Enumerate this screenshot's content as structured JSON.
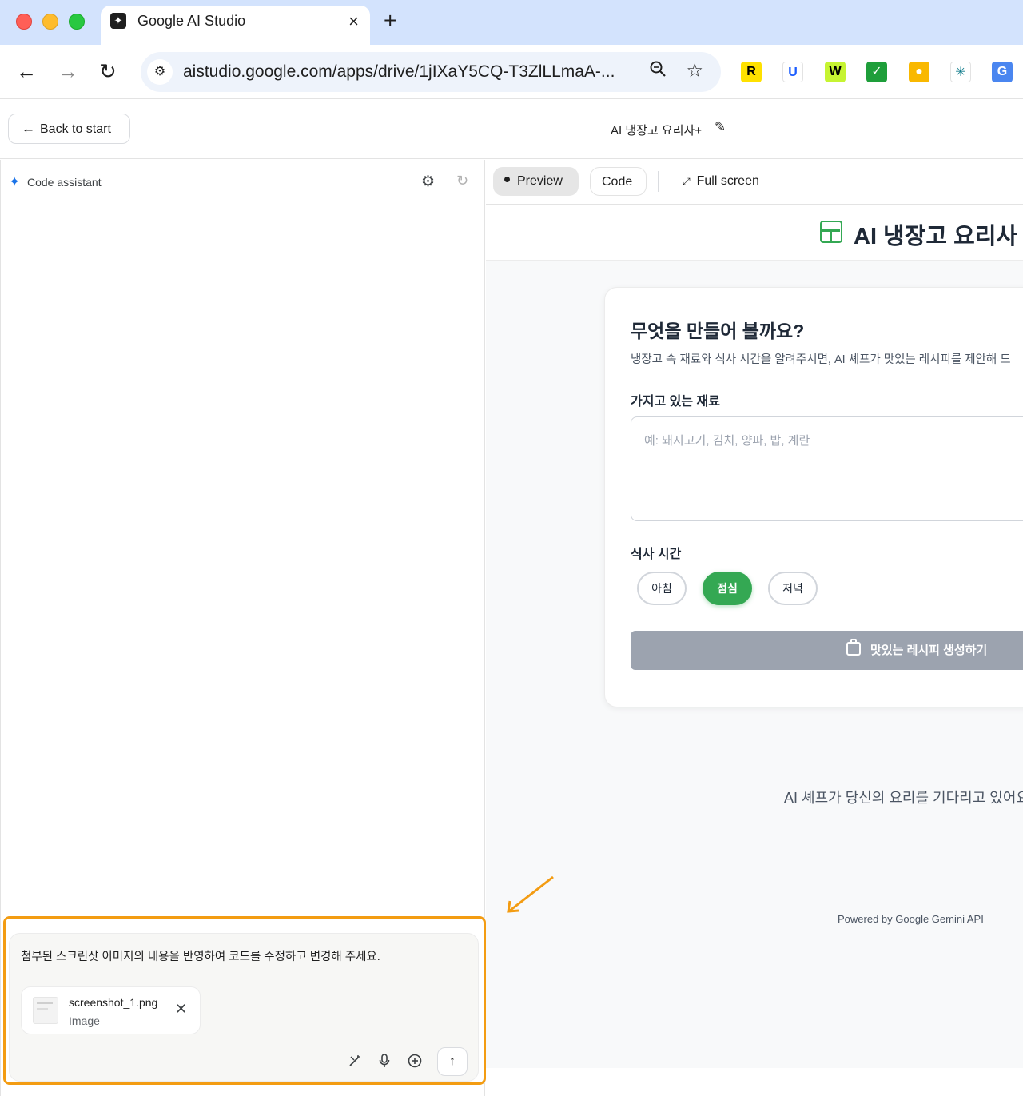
{
  "browser": {
    "tab_title": "Google AI Studio",
    "url": "aistudio.google.com/apps/drive/1jIXaY5CQ-T3ZlLLmaA-...",
    "extensions": [
      {
        "name": "r-extension-icon",
        "glyph": "R",
        "bg": "#ffe100",
        "fg": "#000000"
      },
      {
        "name": "u-extension-icon",
        "glyph": "U",
        "bg": "#ffffff",
        "fg": "#1a5cff"
      },
      {
        "name": "w-extension-icon",
        "glyph": "W",
        "bg": "#c6f432",
        "fg": "#000000"
      },
      {
        "name": "check-extension-icon",
        "glyph": "✓",
        "bg": "#1e9e3a",
        "fg": "#ffffff"
      },
      {
        "name": "bulb-extension-icon",
        "glyph": "●",
        "bg": "#f9b800",
        "fg": "#ffffff"
      },
      {
        "name": "network-extension-icon",
        "glyph": "✳",
        "bg": "#ffffff",
        "fg": "#0e7a8a"
      },
      {
        "name": "translate-extension-icon",
        "glyph": "G",
        "bg": "#4a86f0",
        "fg": "#ffffff"
      }
    ]
  },
  "header": {
    "back_label": "Back to start",
    "app_title": "AI 냉장고 요리사+"
  },
  "assistant": {
    "title": "Code assistant",
    "prompt": "첨부된 스크린샷 이미지의 내용을 반영하여 코드를 수정하고 변경해 주세요.",
    "attachment": {
      "name": "screenshot_1.png",
      "type": "Image"
    }
  },
  "view_tabs": {
    "preview": "Preview",
    "code": "Code",
    "fullscreen": "Full screen"
  },
  "preview_app": {
    "title": "AI 냉장고 요리사",
    "card_heading": "무엇을 만들어 볼까요?",
    "card_sub": "냉장고 속 재료와 식사 시간을 알려주시면, AI 셰프가 맛있는 레시피를 제안해 드",
    "ingredients_label": "가지고 있는 재료",
    "ingredients_placeholder": "예: 돼지고기, 김치, 양파, 밥, 계란",
    "meal_label": "식사 시간",
    "meals": [
      "아침",
      "점심",
      "저녁"
    ],
    "selected_meal": "점심",
    "generate_label": "맛있는 레시피 생성하기",
    "waiting": "AI 셰프가 당신의 요리를 기다리고 있어요",
    "powered": "Powered by Google Gemini API"
  },
  "colors": {
    "accent_green": "#34a853",
    "highlight_orange": "#f39c12",
    "disabled_gray": "#9ca3af"
  }
}
